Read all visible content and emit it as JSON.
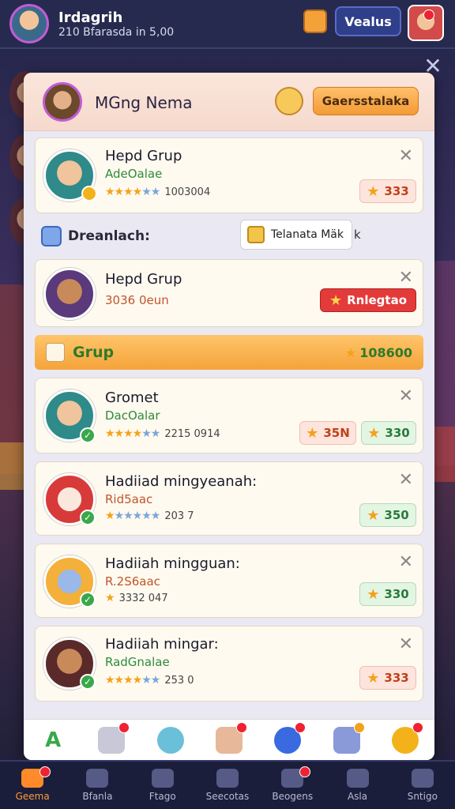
{
  "header": {
    "name": "Irdagrih",
    "subtitle": "210 Bfarasda in 5,00",
    "button_label": "Vealus"
  },
  "modal": {
    "title": "MGng Nema",
    "action_button": "Gaersstalaka",
    "cards": [
      {
        "title": "Hepd Grup",
        "sub": "AdeOalae",
        "stars_on": 4,
        "stars_total": 6,
        "num": "1003004",
        "pill": "333",
        "pill_style": "pink"
      },
      {
        "title": "Hepd Grup",
        "sub": "3036 0eun",
        "pill": "Rnlegtao",
        "pill_style": "red"
      },
      {
        "title": "Gromet",
        "sub": "DacOalar",
        "stars_on": 4,
        "stars_total": 6,
        "num": "2215 0914",
        "pill": "35N",
        "pill2": "330"
      },
      {
        "title": "Hadiiad mingyeanah:",
        "sub": "Rid5aac",
        "stars_on": 1,
        "stars_total": 6,
        "num": "203 7",
        "pill": "350"
      },
      {
        "title": "Hadiiah mingguan:",
        "sub": "R.2S6aac",
        "num": "3332 047",
        "pill": "330"
      },
      {
        "title": "Hadiiah mingar:",
        "sub": "RadGnalae",
        "stars_on": 4,
        "stars_total": 6,
        "num": "253 0",
        "pill": "333"
      }
    ],
    "section_label": "Dreanlach:",
    "section_button": "Telanata Mäk",
    "section_k": "k",
    "grup_label": "Grup",
    "grup_value": "108600"
  },
  "nav": {
    "items": [
      "Geema",
      "Bfanla",
      "Ftago",
      "Seecotas",
      "Beogens",
      "Asla",
      "Sntigo"
    ]
  },
  "icons": {
    "close": "✕",
    "star": "★"
  }
}
